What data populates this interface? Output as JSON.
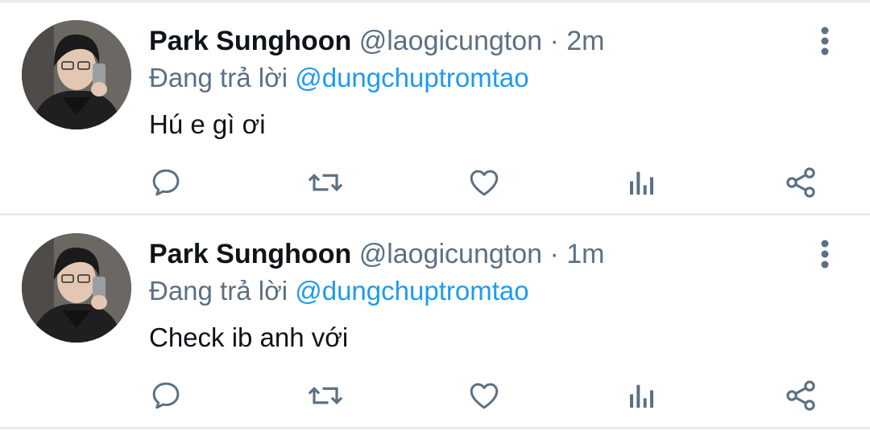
{
  "colors": {
    "text": "#0f1419",
    "secondary": "#5b7083",
    "mention": "#1d9bf0",
    "divider": "#e9ecee"
  },
  "tweets": [
    {
      "name": "Park Sunghoon",
      "handle": "@laogicungton",
      "separator": "·",
      "time": "2m",
      "reply_prefix": "Đang trả lời",
      "reply_to": "@dungchuptromtao",
      "text": "Hú e gì ơi",
      "actions": [
        "reply-icon",
        "retweet-icon",
        "like-icon",
        "analytics-icon",
        "share-icon"
      ]
    },
    {
      "name": "Park Sunghoon",
      "handle": "@laogicungton",
      "separator": "·",
      "time": "1m",
      "reply_prefix": "Đang trả lời",
      "reply_to": "@dungchuptromtao",
      "text": "Check ib anh với",
      "actions": [
        "reply-icon",
        "retweet-icon",
        "like-icon",
        "analytics-icon",
        "share-icon"
      ]
    }
  ]
}
